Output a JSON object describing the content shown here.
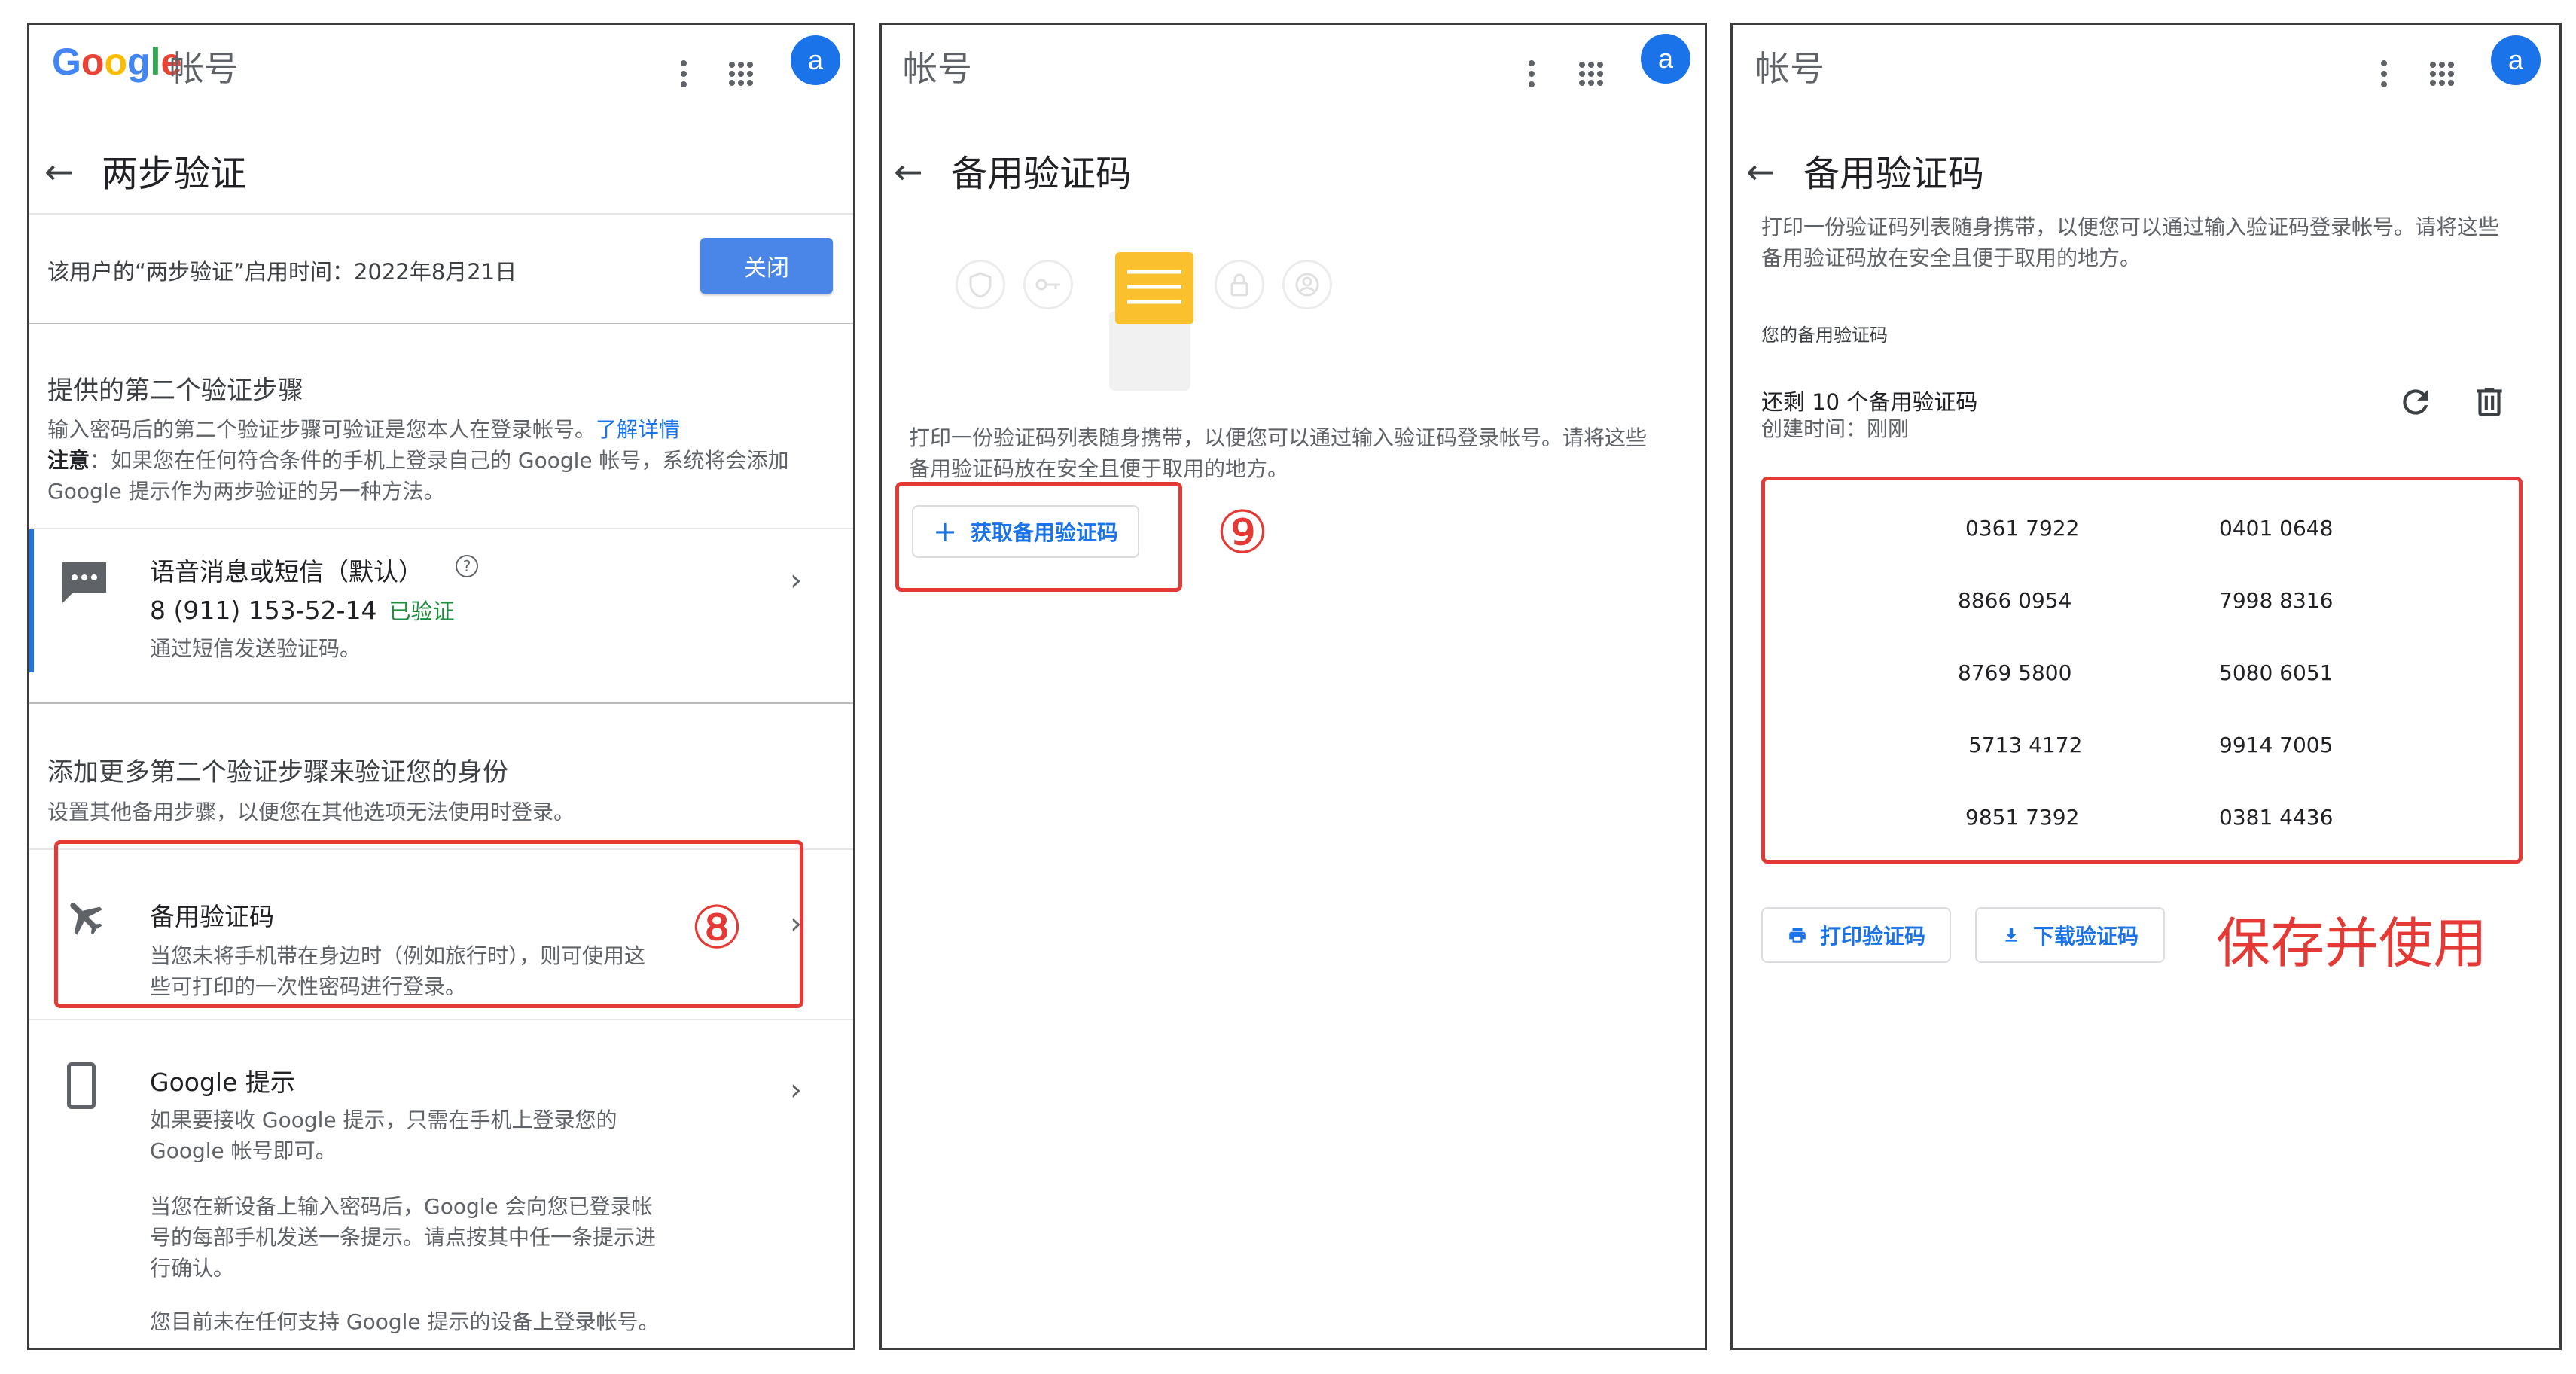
{
  "topbar": {
    "google_letters": [
      "G",
      "o",
      "o",
      "g",
      "l",
      "e"
    ],
    "google_colors": [
      "#4285F4",
      "#EA4335",
      "#FBBC05",
      "#4285F4",
      "#34A853",
      "#EA4335"
    ],
    "account_label": "帐号",
    "avatar_letter": "a"
  },
  "panel1": {
    "title": "两步验证",
    "enabled_text": "该用户的“两步验证”启用时间：2022年8月21日",
    "close_button": "关闭",
    "second_step_heading": "提供的第二个验证步骤",
    "second_step_desc": "输入密码后的第二个验证步骤可验证是您本人在登录帐号。",
    "learn_more": "了解详情",
    "note_label": "注意",
    "note_text": "：如果您在任何符合条件的手机上登录自己的 Google 帐号，系统将会添加",
    "note_text2": "Google 提示作为两步验证的另一种方法。",
    "voice_title": "语音消息或短信（默认）",
    "phone_number": "8 (911) 153-52-14",
    "verified": "已验证",
    "voice_desc": "通过短信发送验证码。",
    "add_more_heading": "添加更多第二个验证步骤来验证您的身份",
    "add_more_desc": "设置其他备用步骤，以便您在其他选项无法使用时登录。",
    "backup_title": "备用验证码",
    "backup_desc1": "当您未将手机带在身边时（例如旅行时），则可使用这",
    "backup_desc2": "些可打印的一次性密码进行登录。",
    "step_marker": "⑧",
    "prompt_title": "Google 提示",
    "prompt_desc1": "如果要接收 Google 提示，只需在手机上登录您的",
    "prompt_desc2": "Google 帐号即可。",
    "prompt_desc3": "当您在新设备上输入密码后，Google 会向您已登录帐",
    "prompt_desc4": "号的每部手机发送一条提示。请点按其中任一条提示进",
    "prompt_desc5": "行确认。",
    "prompt_desc6": "您目前未在任何支持 Google 提示的设备上登录帐号。"
  },
  "panel2": {
    "title": "备用验证码",
    "desc1": "打印一份验证码列表随身携带，以便您可以通过输入验证码登录帐号。请将这些",
    "desc2": "备用验证码放在安全且便于取用的地方。",
    "get_codes_button": "获取备用验证码",
    "step_marker": "⑨"
  },
  "panel3": {
    "title": "备用验证码",
    "desc1": "打印一份验证码列表随身携带，以便您可以通过输入验证码登录帐号。请将这些",
    "desc2": "备用验证码放在安全且便于取用的地方。",
    "your_codes_label": "您的备用验证码",
    "remaining": "还剩 10 个备用验证码",
    "created": "创建时间：刚刚",
    "codes": [
      "0361 7922",
      "0401 0648",
      "8866 0954",
      "7998 8316",
      "8769 5800",
      "5080 6051",
      "5713 4172",
      "9914 7005",
      "9851 7392",
      "0381 4436"
    ],
    "print_button": "打印验证码",
    "download_button": "下载验证码",
    "save_note": "保存并使用"
  },
  "colors": {
    "accent_blue": "#1a73e8",
    "button_blue": "#4a86e8",
    "verified_green": "#1e8e3e",
    "annotation_red": "#e53935"
  }
}
